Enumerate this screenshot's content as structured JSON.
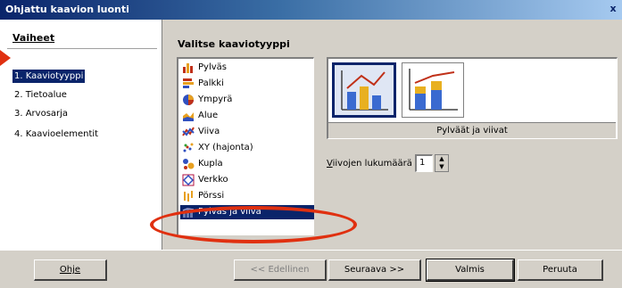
{
  "window": {
    "title": "Ohjattu kaavion luonti",
    "close_glyph": "x"
  },
  "steps": {
    "title": "Vaiheet",
    "items": [
      {
        "label": "1. Kaaviotyyppi",
        "active": true
      },
      {
        "label": "2. Tietoalue",
        "active": false
      },
      {
        "label": "3. Arvosarja",
        "active": false
      },
      {
        "label": "4. Kaavioelementit",
        "active": false
      }
    ]
  },
  "chart_types": {
    "title": "Valitse kaaviotyyppi",
    "items": [
      {
        "label": "Pylväs",
        "icon": "column-chart-icon"
      },
      {
        "label": "Palkki",
        "icon": "bar-chart-icon"
      },
      {
        "label": "Ympyrä",
        "icon": "pie-chart-icon"
      },
      {
        "label": "Alue",
        "icon": "area-chart-icon"
      },
      {
        "label": "Viiva",
        "icon": "line-chart-icon"
      },
      {
        "label": "XY (hajonta)",
        "icon": "scatter-chart-icon"
      },
      {
        "label": "Kupla",
        "icon": "bubble-chart-icon"
      },
      {
        "label": "Verkko",
        "icon": "net-chart-icon"
      },
      {
        "label": "Pörssi",
        "icon": "stock-chart-icon"
      },
      {
        "label": "Pylväs ja viiva",
        "icon": "column-line-chart-icon",
        "selected": true
      }
    ]
  },
  "variant": {
    "selected_label": "Pylväät ja viivat"
  },
  "lines": {
    "label_prefix": "V",
    "label_rest": "iivojen lukumäärä",
    "value": "1"
  },
  "buttons": {
    "help": "Ohje",
    "back": "<< Edellinen",
    "next": "Seuraava >>",
    "finish": "Valmis",
    "cancel": "Peruuta"
  },
  "colors": {
    "titlebar_start": "#0a246a",
    "selection": "#0a246a",
    "annotation_red": "#e03010",
    "dialog_bg": "#d4d0c8"
  }
}
